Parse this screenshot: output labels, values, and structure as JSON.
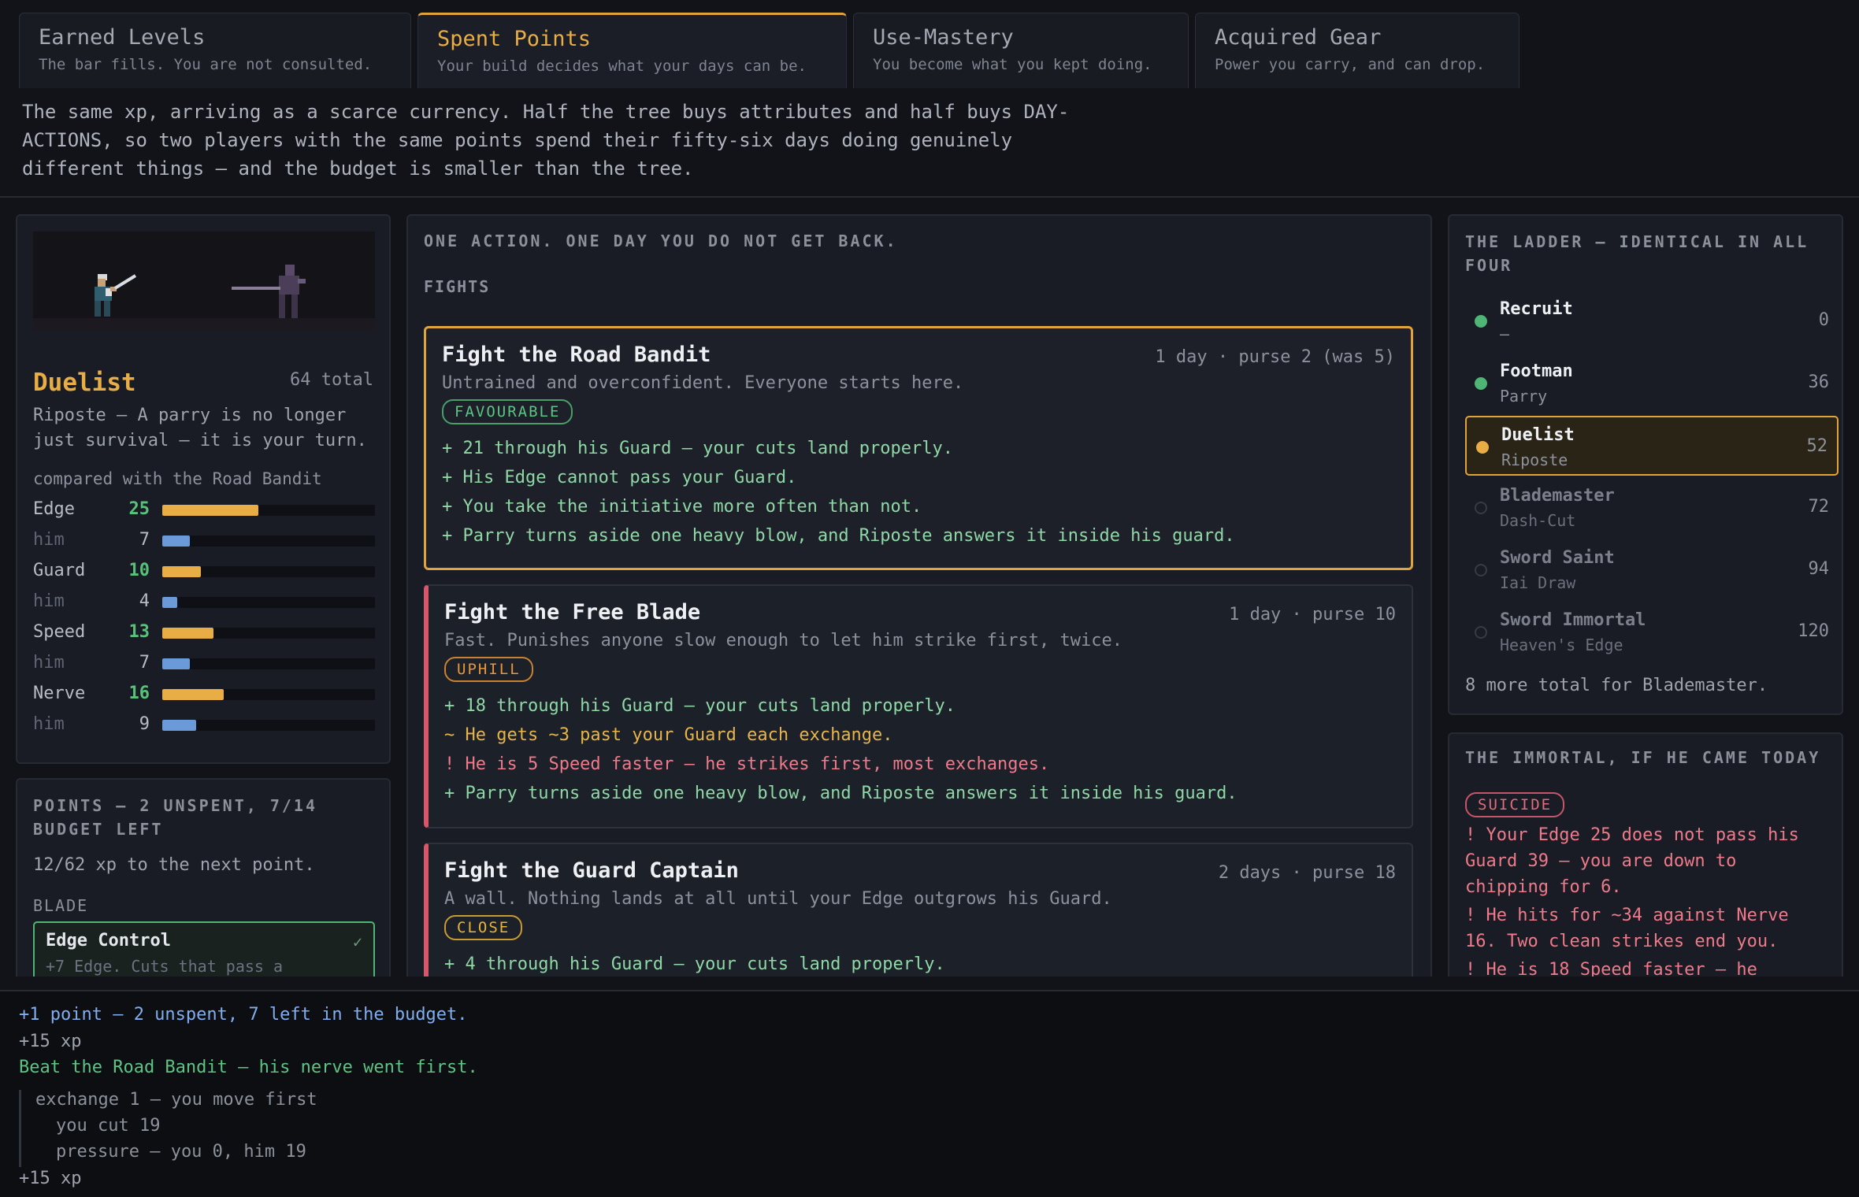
{
  "tabs": [
    {
      "title": "Earned Levels",
      "sub": "The bar fills. You are not consulted."
    },
    {
      "title": "Spent Points",
      "sub": "Your build decides what your days can be."
    },
    {
      "title": "Use-Mastery",
      "sub": "You become what you kept doing."
    },
    {
      "title": "Acquired Gear",
      "sub": "Power you carry, and can drop."
    }
  ],
  "intro": "The same xp, arriving as a scarce currency. Half the tree buys attributes and half buys DAY-ACTIONS, so two players with the same points spend their fifty-six days doing genuinely different things — and the budget is smaller than the tree.",
  "character": {
    "class_name": "Duelist",
    "total": "64 total",
    "desc": "Riposte — A parry is no longer just survival — it is your turn.",
    "compare": "compared with the Road Bandit",
    "stats": [
      {
        "label": "Edge",
        "value": 25,
        "fraction": 0.45
      },
      {
        "label": "him",
        "value": 7,
        "fraction": 0.13
      },
      {
        "label": "Guard",
        "value": 10,
        "fraction": 0.18
      },
      {
        "label": "him",
        "value": 4,
        "fraction": 0.07
      },
      {
        "label": "Speed",
        "value": 13,
        "fraction": 0.24
      },
      {
        "label": "him",
        "value": 7,
        "fraction": 0.13
      },
      {
        "label": "Nerve",
        "value": 16,
        "fraction": 0.29
      },
      {
        "label": "him",
        "value": 9,
        "fraction": 0.16
      }
    ]
  },
  "points": {
    "caption": "Points — 2 unspent, 7/14 budget left",
    "xp": "12/62 xp to the next point.",
    "group": "BLADE",
    "skill_name": "Edge Control",
    "skill_check": "✓",
    "skill_desc": "+7 Edge. Cuts that pass a"
  },
  "actions": {
    "caption": "One action. One day you do not get back.",
    "section": "FIGHTS",
    "fights": [
      {
        "title": "Fight the Road Bandit",
        "meta": "1 day · purse 2 (was 5)",
        "desc": "Untrained and overconfident. Everyone starts here.",
        "badge": "FAVOURABLE",
        "lines": [
          {
            "kind": "plus",
            "text": "+ 21 through his Guard — your cuts land properly."
          },
          {
            "kind": "plus",
            "text": "+ His Edge cannot pass your Guard."
          },
          {
            "kind": "plus",
            "text": "+ You take the initiative more often than not."
          },
          {
            "kind": "plus",
            "text": "+ Parry turns aside one heavy blow, and Riposte answers it inside his guard."
          }
        ]
      },
      {
        "title": "Fight the Free Blade",
        "meta": "1 day · purse 10",
        "desc": "Fast. Punishes anyone slow enough to let him strike first, twice.",
        "badge": "UPHILL",
        "lines": [
          {
            "kind": "plus",
            "text": "+ 18 through his Guard — your cuts land properly."
          },
          {
            "kind": "tilde",
            "text": "~ He gets ~3 past your Guard each exchange."
          },
          {
            "kind": "bang",
            "text": "! He is 5 Speed faster — he strikes first, most exchanges."
          },
          {
            "kind": "plus",
            "text": "+ Parry turns aside one heavy blow, and Riposte answers it inside his guard."
          }
        ]
      },
      {
        "title": "Fight the Guard Captain",
        "meta": "2 days · purse 18",
        "desc": "A wall. Nothing lands at all until your Edge outgrows his Guard.",
        "badge": "CLOSE",
        "lines": [
          {
            "kind": "plus",
            "text": "+ 4 through his Guard — your cuts land properly."
          }
        ]
      }
    ]
  },
  "ladder": {
    "caption": "The Ladder — identical in all four",
    "rungs": [
      {
        "name": "Recruit",
        "skill": "—",
        "cost": "0",
        "state": "done"
      },
      {
        "name": "Footman",
        "skill": "Parry",
        "cost": "36",
        "state": "done"
      },
      {
        "name": "Duelist",
        "skill": "Riposte",
        "cost": "52",
        "state": "current"
      },
      {
        "name": "Blademaster",
        "skill": "Dash-Cut",
        "cost": "72",
        "state": "locked"
      },
      {
        "name": "Sword Saint",
        "skill": "Iai Draw",
        "cost": "94",
        "state": "locked"
      },
      {
        "name": "Sword Immortal",
        "skill": "Heaven's Edge",
        "cost": "120",
        "state": "locked"
      }
    ],
    "note": "8 more total for Blademaster."
  },
  "immortal": {
    "caption": "The Immortal, if he came today",
    "badge": "SUICIDE",
    "lines": [
      "! Your Edge 25 does not pass his Guard 39 — you are down to chipping for 6.",
      "! He hits for ~34 against Nerve 16. Two clean strikes end you.",
      "! He is 18 Speed faster — he"
    ]
  },
  "log": {
    "l1": "+1 point — 2 unspent, 7 left in the budget.",
    "l2": "+15 xp",
    "l3": "Beat the Road Bandit — his nerve went first.",
    "q1": "exchange 1 — you move first",
    "q2": "you cut 19",
    "q3": "pressure — you 0, him 19",
    "l4": "+15 xp"
  },
  "colors": {
    "accent": "#e8ad45",
    "good": "#5dc483",
    "danger": "#ee7a8a",
    "player_bar": "#e8ad45",
    "enemy_bar": "#6a9ad8"
  }
}
